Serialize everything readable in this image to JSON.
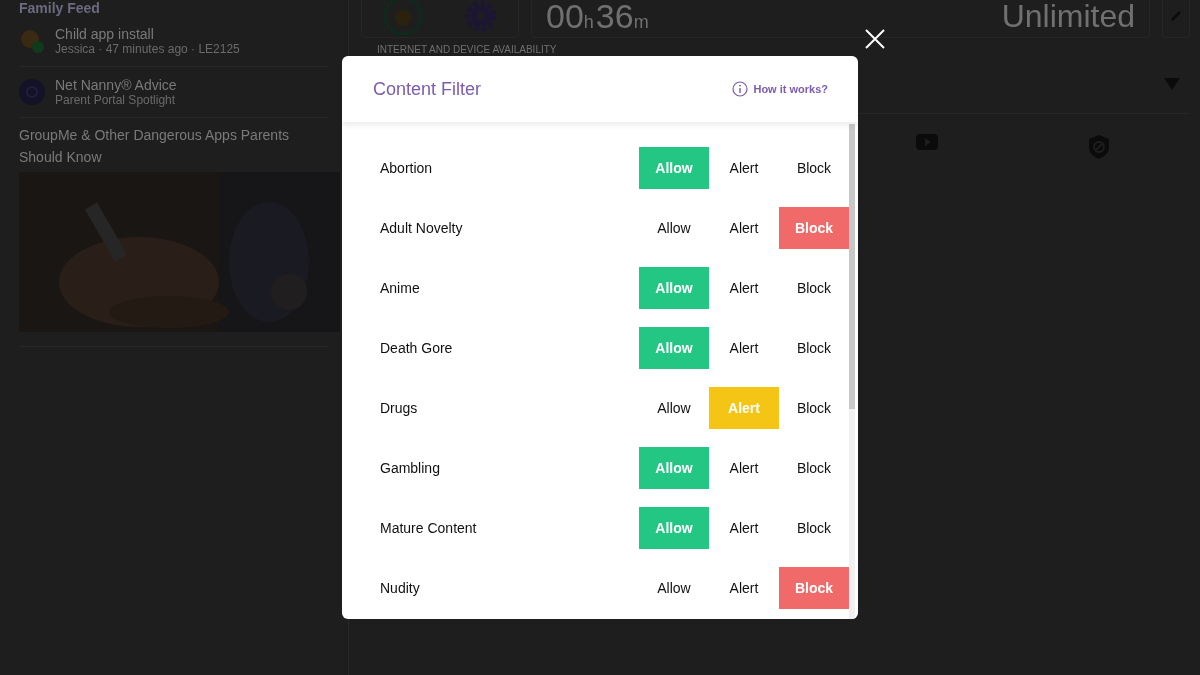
{
  "background": {
    "feed_title": "Family Feed",
    "feed_items": [
      {
        "kind": "install",
        "title": "Child app install",
        "subtitle": "Jessica · 47 minutes ago · LE2125"
      },
      {
        "kind": "advice",
        "title": "Net Nanny® Advice",
        "subtitle": "Parent Portal Spotlight"
      }
    ],
    "article_title": "GroupMe & Other Dangerous Apps Parents Should Know",
    "screen_time": {
      "hours": "00",
      "hours_unit": "h",
      "minutes": "36",
      "minutes_unit": "m",
      "limit": "Unlimited"
    },
    "section_label": "INTERNET AND DEVICE AVAILABILITY"
  },
  "modal": {
    "title": "Content Filter",
    "help_link": "How it works?",
    "rows": [
      {
        "label": "Abortion",
        "options": [
          {
            "kind": "allow",
            "label": "Allow",
            "selected": true
          },
          {
            "kind": "alert",
            "label": "Alert",
            "selected": false
          },
          {
            "kind": "block",
            "label": "Block",
            "selected": false
          }
        ]
      },
      {
        "label": "Adult Novelty",
        "options": [
          {
            "kind": "allow",
            "label": "Allow",
            "selected": false
          },
          {
            "kind": "alert",
            "label": "Alert",
            "selected": false
          },
          {
            "kind": "block",
            "label": "Block",
            "selected": true
          }
        ]
      },
      {
        "label": "Anime",
        "options": [
          {
            "kind": "allow",
            "label": "Allow",
            "selected": true
          },
          {
            "kind": "alert",
            "label": "Alert",
            "selected": false
          },
          {
            "kind": "block",
            "label": "Block",
            "selected": false
          }
        ]
      },
      {
        "label": "Death Gore",
        "options": [
          {
            "kind": "allow",
            "label": "Allow",
            "selected": true
          },
          {
            "kind": "alert",
            "label": "Alert",
            "selected": false
          },
          {
            "kind": "block",
            "label": "Block",
            "selected": false
          }
        ]
      },
      {
        "label": "Drugs",
        "options": [
          {
            "kind": "allow",
            "label": "Allow",
            "selected": false
          },
          {
            "kind": "alert",
            "label": "Alert",
            "selected": true
          },
          {
            "kind": "block",
            "label": "Block",
            "selected": false
          }
        ]
      },
      {
        "label": "Gambling",
        "options": [
          {
            "kind": "allow",
            "label": "Allow",
            "selected": true
          },
          {
            "kind": "alert",
            "label": "Alert",
            "selected": false
          },
          {
            "kind": "block",
            "label": "Block",
            "selected": false
          }
        ]
      },
      {
        "label": "Mature Content",
        "options": [
          {
            "kind": "allow",
            "label": "Allow",
            "selected": true
          },
          {
            "kind": "alert",
            "label": "Alert",
            "selected": false
          },
          {
            "kind": "block",
            "label": "Block",
            "selected": false
          }
        ]
      },
      {
        "label": "Nudity",
        "options": [
          {
            "kind": "allow",
            "label": "Allow",
            "selected": false
          },
          {
            "kind": "alert",
            "label": "Alert",
            "selected": false
          },
          {
            "kind": "block",
            "label": "Block",
            "selected": true
          }
        ]
      }
    ]
  }
}
